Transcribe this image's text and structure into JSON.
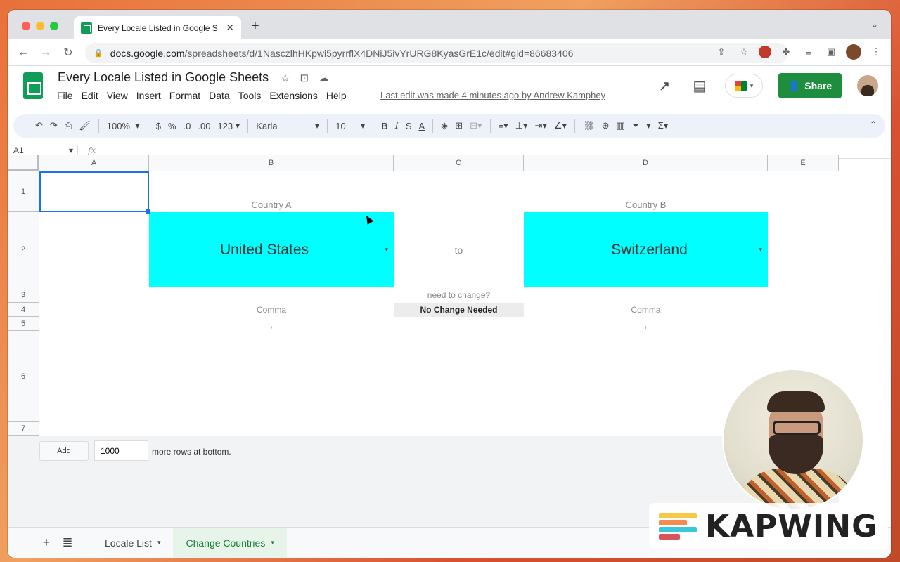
{
  "browser": {
    "tab_title": "Every Locale Listed in Google S",
    "url_host": "docs.google.com",
    "url_path": "/spreadsheets/d/1NasczlhHKpwi5pyrrflX4DNiJ5ivYrURG8KyasGrE1c/edit#gid=86683406"
  },
  "doc": {
    "title": "Every Locale Listed in Google Sheets",
    "menus": [
      "File",
      "Edit",
      "View",
      "Insert",
      "Format",
      "Data",
      "Tools",
      "Extensions",
      "Help"
    ],
    "last_edit": "Last edit was made 4 minutes ago by Andrew Kamphey",
    "share_label": "Share"
  },
  "toolbar": {
    "zoom": "100%",
    "currency": "$",
    "percent": "%",
    "dec_less": ".0",
    "dec_more": ".00",
    "format_123": "123",
    "font": "Karla",
    "size": "10"
  },
  "formula_bar": {
    "cell_ref": "A1",
    "fx": "fx"
  },
  "columns": [
    "A",
    "B",
    "C",
    "D",
    "E"
  ],
  "rows": [
    "1",
    "2",
    "3",
    "4",
    "5",
    "6",
    "7"
  ],
  "cells": {
    "country_a_label": "Country A",
    "country_b_label": "Country B",
    "country_a": "United States",
    "country_b": "Switzerland",
    "to": "to",
    "need_to_change": "need to change?",
    "no_change": "No Change Needed",
    "comma_a": "Comma",
    "comma_b": "Comma",
    "comma_a_val": ",",
    "comma_b_val": ","
  },
  "add_rows": {
    "button": "Add",
    "count": "1000",
    "text": "more rows at bottom."
  },
  "sheets": [
    {
      "name": "Locale List",
      "active": false
    },
    {
      "name": "Change Countries",
      "active": true
    }
  ],
  "overlay": {
    "brand": "KAPWING"
  },
  "colors": {
    "cyan_fill": "#00ffff",
    "share_green": "#1e8e3e",
    "selection_blue": "#1a73e8"
  }
}
